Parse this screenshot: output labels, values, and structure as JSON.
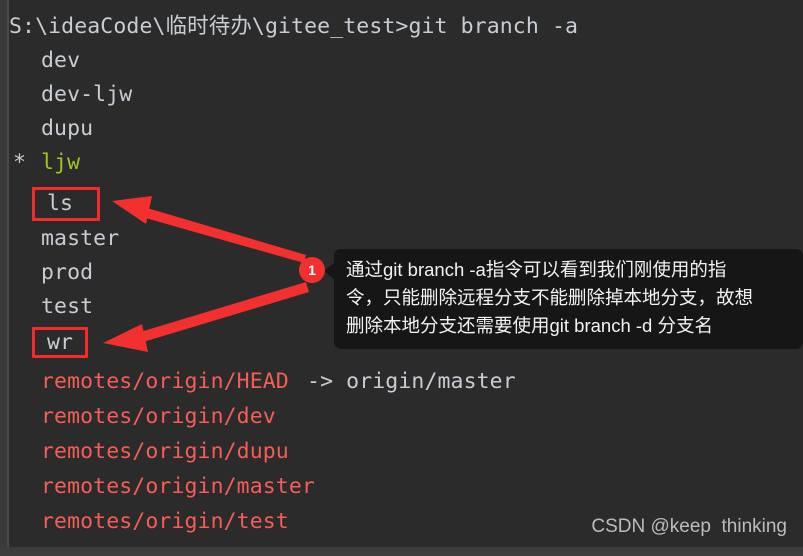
{
  "terminal": {
    "background_color": "#2b2b2b",
    "default_text_color": "#c8cdd4",
    "current_branch_color": "#9ec428",
    "remote_branch_color": "#f55d58",
    "prompt_line": "S:\\ideaCode\\临时待办\\gitee_test>git branch -a",
    "lines": [
      {
        "indent": "  ",
        "text": "dev",
        "color": "gray",
        "marker": ""
      },
      {
        "indent": "  ",
        "text": "dev-ljw",
        "color": "gray",
        "marker": ""
      },
      {
        "indent": "  ",
        "text": "dupu",
        "color": "gray",
        "marker": ""
      },
      {
        "indent": "  ",
        "text": "ljw",
        "color": "green",
        "marker": "*"
      },
      {
        "indent": "  ",
        "text": "ls",
        "color": "gray",
        "marker": ""
      },
      {
        "indent": "  ",
        "text": "master",
        "color": "gray",
        "marker": ""
      },
      {
        "indent": "  ",
        "text": "prod",
        "color": "gray",
        "marker": ""
      },
      {
        "indent": "  ",
        "text": "test",
        "color": "gray",
        "marker": ""
      },
      {
        "indent": "  ",
        "text": "wr",
        "color": "gray",
        "marker": ""
      },
      {
        "indent": "  ",
        "text": "remotes/origin/HEAD",
        "suffix": " -> origin/master",
        "color": "red",
        "marker": ""
      },
      {
        "indent": "  ",
        "text": "remotes/origin/dev",
        "color": "red",
        "marker": ""
      },
      {
        "indent": "  ",
        "text": "remotes/origin/dupu",
        "color": "red",
        "marker": ""
      },
      {
        "indent": "  ",
        "text": "remotes/origin/master",
        "color": "red",
        "marker": ""
      },
      {
        "indent": "  ",
        "text": "remotes/origin/test",
        "color": "red",
        "marker": ""
      }
    ]
  },
  "annotations": {
    "badge_number": "1",
    "badge_color": "#f23030",
    "highlight_color": "#f32b2b",
    "arrow_color": "#f23030",
    "highlighted_branches": [
      "ls",
      "wr"
    ],
    "tooltip": {
      "background_color": "#161616",
      "text_color": "#f2f2f2",
      "line1": "通过git branch -a指令可以看到我们刚使用的指",
      "line2": "令，只能删除远程分支不能删除掉本地分支，故想",
      "line3": "删除本地分支还需要使用git branch -d 分支名"
    }
  },
  "watermark": {
    "text": "CSDN @keep  thinking",
    "color": "#b9bcc0"
  }
}
